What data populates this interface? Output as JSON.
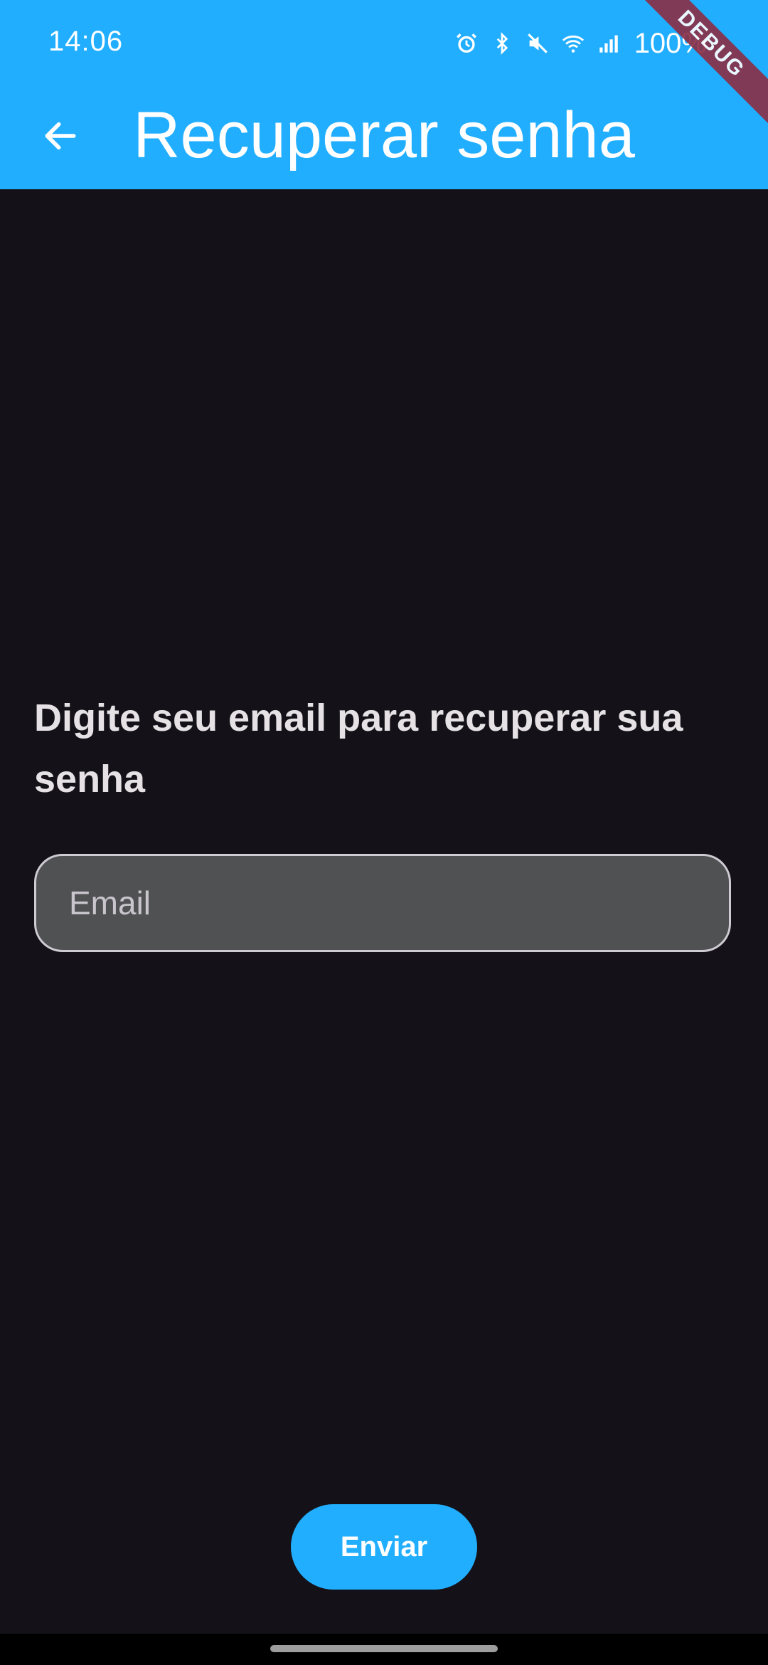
{
  "status_bar": {
    "time": "14:06",
    "battery": "100%",
    "icons": [
      "alarm-icon",
      "bluetooth-icon",
      "mute-icon",
      "wifi-icon",
      "signal-icon"
    ]
  },
  "app_bar": {
    "title": "Recuperar senha",
    "back_icon": "arrow-left-icon",
    "debug_label": "DEBUG"
  },
  "form": {
    "prompt": "Digite seu email para recuperar sua senha",
    "email_placeholder": "Email",
    "email_value": ""
  },
  "actions": {
    "send_label": "Enviar"
  },
  "colors": {
    "accent": "#21AEFF",
    "background": "#141218",
    "field_fill": "#505153",
    "text": "#E6E1E5"
  }
}
